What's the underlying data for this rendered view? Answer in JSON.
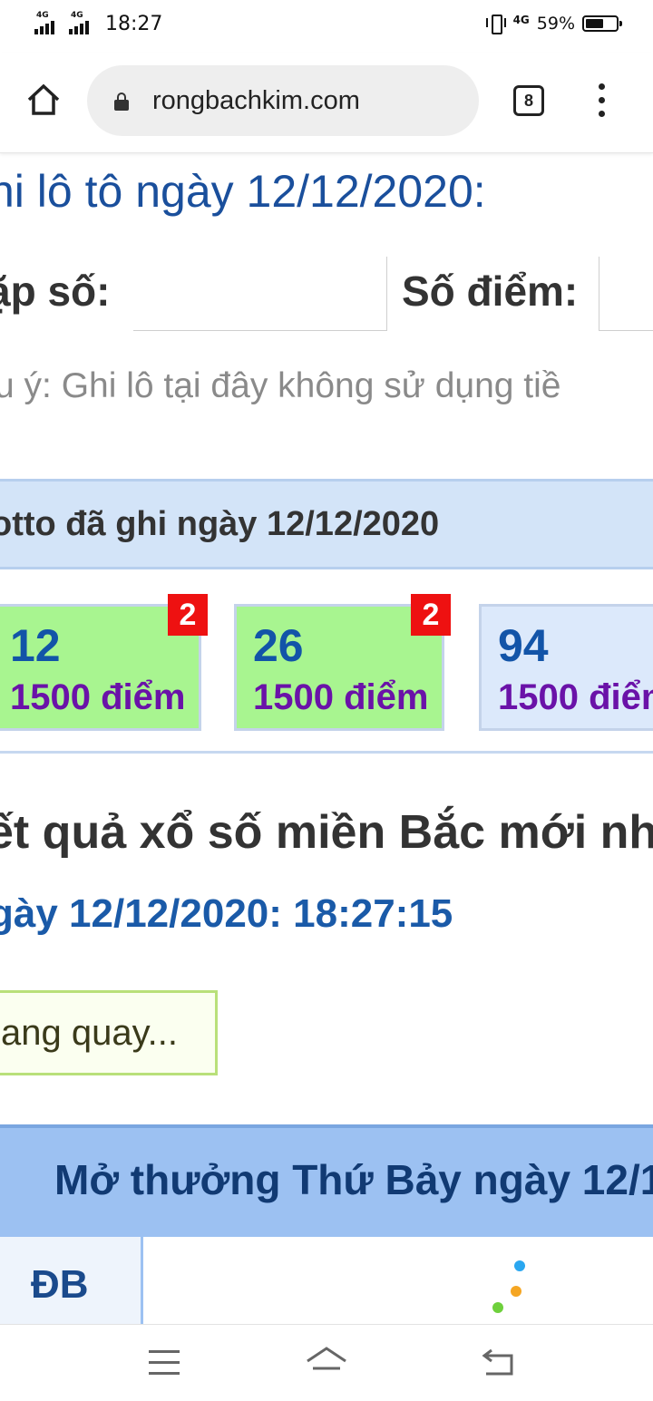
{
  "status_bar": {
    "signal_1": "4G",
    "signal_2": "4G",
    "time": "18:27",
    "network": "4G",
    "battery_percent": "59%",
    "battery_level": 0.59
  },
  "browser": {
    "url": "rongbachkim.com",
    "tab_count": "8"
  },
  "form": {
    "heading": "hi lô tô ngày 12/12/2020:",
    "cap_so_label": "ặp số:",
    "cap_so_value": "",
    "so_diem_label": "Số điểm:",
    "so_diem_value": "",
    "note": "u ý: Ghi lô tại đây không sử dụng tiề"
  },
  "lotto": {
    "header": "otto đã ghi ngày 12/12/2020",
    "cards": [
      {
        "number": "12",
        "points": "1500 điểm",
        "badge": "2",
        "color": "#a8f590"
      },
      {
        "number": "26",
        "points": "1500 điểm",
        "badge": "2",
        "color": "#a8f590"
      },
      {
        "number": "94",
        "points": "1500 điểm",
        "badge": "",
        "color": "#dce9fb"
      }
    ]
  },
  "results": {
    "title": "ết quả xổ số miền Bắc mới nh",
    "datetime": "gày 12/12/2020: 18:27:15",
    "status": "ang quay...",
    "table_header": "Mở thưởng Thứ Bảy ngày 12/1",
    "rows": [
      {
        "label": "ĐB",
        "value": ""
      }
    ]
  },
  "colors": {
    "heading_blue": "#1a4f9c",
    "lotto_header_bg": "#d3e4f8",
    "card_green": "#a8f590",
    "badge_red": "#ee1111",
    "points_purple": "#6a12a8",
    "result_header_bg": "#9cc1f2"
  },
  "navbar": {
    "icons": [
      "menu-icon",
      "home-icon",
      "back-icon"
    ]
  }
}
